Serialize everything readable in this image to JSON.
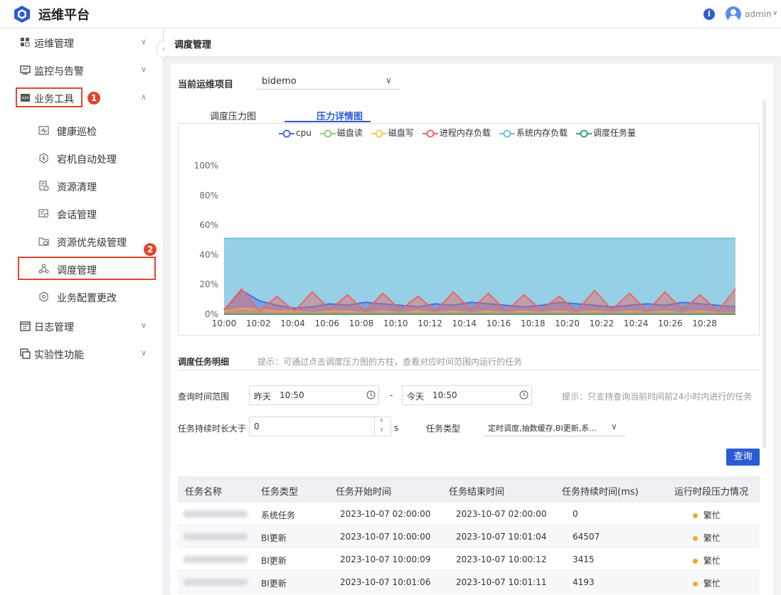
{
  "app": {
    "title": "运维平台",
    "user": "admin"
  },
  "sidebar": {
    "items": [
      {
        "label": "运维管理",
        "icon": "grid-icon"
      },
      {
        "label": "监控与告警",
        "icon": "monitor-icon"
      },
      {
        "label": "业务工具",
        "icon": "code-icon"
      },
      {
        "label": "日志管理",
        "icon": "calendar-icon"
      },
      {
        "label": "实验性功能",
        "icon": "window-icon"
      }
    ],
    "subitems": [
      {
        "label": "健康巡检",
        "icon": "pulse-icon"
      },
      {
        "label": "宕机自动处理",
        "icon": "power-icon"
      },
      {
        "label": "资源清理",
        "icon": "clean-icon"
      },
      {
        "label": "会话管理",
        "icon": "session-icon"
      },
      {
        "label": "资源优先级管理",
        "icon": "priority-icon"
      },
      {
        "label": "调度管理",
        "icon": "schedule-icon"
      },
      {
        "label": "业务配置更改",
        "icon": "config-icon"
      }
    ],
    "badges": [
      "1",
      "2"
    ]
  },
  "page": {
    "title": "调度管理"
  },
  "project": {
    "label": "当前运维项目",
    "value": "bidemo"
  },
  "tabs": [
    "调度压力图",
    "压力详情图"
  ],
  "chart_data": {
    "type": "area",
    "x": [
      "10:00",
      "10:02",
      "10:04",
      "10:06",
      "10:08",
      "10:10",
      "10:12",
      "10:14",
      "10:16",
      "10:18",
      "10:20",
      "10:22",
      "10:24",
      "10:26",
      "10:28"
    ],
    "yticks": [
      "0%",
      "20%",
      "40%",
      "60%",
      "80%",
      "100%"
    ],
    "ylim": [
      0,
      100
    ],
    "legend_position": "top",
    "series": [
      {
        "name": "cpu",
        "color": "#4a6fd6",
        "values": [
          3,
          16,
          9,
          6,
          4,
          5,
          7,
          6,
          8,
          7,
          6,
          5,
          7,
          6,
          8,
          7,
          6,
          5,
          6,
          8,
          7,
          6,
          5,
          6,
          7,
          6,
          8,
          7,
          6,
          5
        ]
      },
      {
        "name": "磁盘读",
        "color": "#91cc75",
        "values": [
          1,
          2,
          1,
          1,
          1,
          1,
          1,
          1,
          1,
          1,
          1,
          1,
          1,
          1,
          1,
          1,
          1,
          1,
          1,
          1,
          1,
          1,
          1,
          1,
          1,
          1,
          1,
          1,
          1,
          1
        ]
      },
      {
        "name": "磁盘写",
        "color": "#fac858",
        "values": [
          2,
          4,
          3,
          2,
          2,
          1,
          2,
          2,
          1,
          2,
          1,
          2,
          1,
          2,
          1,
          2,
          1,
          2,
          1,
          2,
          1,
          2,
          1,
          2,
          1,
          2,
          1,
          2,
          1,
          1
        ]
      },
      {
        "name": "进程内存负载",
        "color": "#ee6666",
        "values": [
          3,
          17,
          2,
          12,
          2,
          15,
          3,
          13,
          2,
          14,
          3,
          12,
          2,
          15,
          3,
          14,
          2,
          13,
          3,
          12,
          2,
          16,
          3,
          14,
          2,
          15,
          3,
          13,
          2,
          17
        ]
      },
      {
        "name": "系统内存负载",
        "color": "#73c0de",
        "values": [
          51,
          51,
          51,
          51,
          51,
          51,
          51,
          51,
          51,
          51,
          51,
          51,
          51,
          51,
          51,
          51,
          51,
          51,
          51,
          51,
          51,
          51,
          51,
          51,
          51,
          51,
          51,
          51,
          51,
          51
        ]
      },
      {
        "name": "调度任务量",
        "color": "#3ba272",
        "values": [
          0,
          0,
          0,
          0,
          0,
          0,
          0,
          0,
          0,
          0,
          0,
          0,
          0,
          0,
          0,
          0,
          0,
          0,
          0,
          0,
          0,
          0,
          0,
          0,
          0,
          0,
          0,
          0,
          0,
          0
        ]
      }
    ]
  },
  "detail": {
    "title": "调度任务明细",
    "hint": "提示：可通过点击调度压力图的方柱，查看对应时间范围内运行的任务",
    "range_label": "查询时间范围",
    "start_day": "昨天",
    "start_time": "10:50",
    "sep": "-",
    "end_day": "今天",
    "end_time": "10:50",
    "range_hint": "提示：只支持查询当前时间前24小时内进行的任务",
    "dur_label": "任务持续时长大于",
    "dur_value": "0",
    "dur_unit": "s",
    "type_label": "任务类型",
    "type_value": "定时调度,抽数缓存,BI更新,系...",
    "query_btn": "查询"
  },
  "table": {
    "headers": [
      "任务名称",
      "任务类型",
      "任务开始时间",
      "任务结束时间",
      "任务持续时间(ms)",
      "运行时段压力情况"
    ],
    "rows": [
      [
        "系统任务",
        "2023-10-07 02:00:00",
        "2023-10-07 02:00:00",
        "0",
        "繁忙"
      ],
      [
        "BI更新",
        "2023-10-07 10:00:00",
        "2023-10-07 10:01:04",
        "64507",
        "繁忙"
      ],
      [
        "BI更新",
        "2023-10-07 10:00:09",
        "2023-10-07 10:00:12",
        "3415",
        "繁忙"
      ],
      [
        "BI更新",
        "2023-10-07 10:01:06",
        "2023-10-07 10:01:11",
        "4193",
        "繁忙"
      ]
    ]
  }
}
